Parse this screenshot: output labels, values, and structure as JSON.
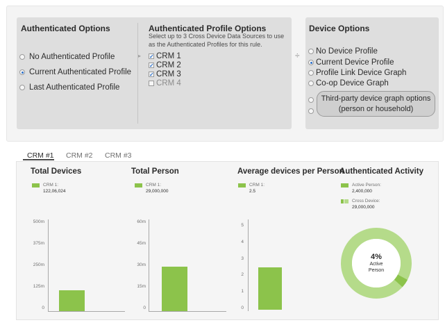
{
  "auth_options": {
    "title": "Authenticated Options",
    "items": [
      {
        "label": "No Authenticated Profile",
        "selected": false
      },
      {
        "label": "Current Authenticated Profile",
        "selected": true
      },
      {
        "label": "Last Authenticated Profile",
        "selected": false
      }
    ]
  },
  "profile_options": {
    "title": "Authenticated Profile Options",
    "description": "Select up to 3 Cross Device Data Sources to use as the Authenticated Profiles for this rule.",
    "items": [
      {
        "label": "CRM 1",
        "checked": true
      },
      {
        "label": "CRM 2",
        "checked": true
      },
      {
        "label": "CRM 3",
        "checked": true
      },
      {
        "label": "CRM 4",
        "checked": false
      }
    ]
  },
  "device_options": {
    "title": "Device Options",
    "items": [
      {
        "label": "No Device Profile",
        "selected": false
      },
      {
        "label": "Current Device Profile",
        "selected": true
      },
      {
        "label": "Profile Link Device Graph",
        "selected": false
      },
      {
        "label": "Co-op Device Graph",
        "selected": false
      }
    ],
    "third_party_line1": "Third-party device graph options",
    "third_party_line2": "(person or household)"
  },
  "tabs": [
    "CRM #1",
    "CRM #2",
    "CRM #3"
  ],
  "accent_color": "#8cc34b",
  "selected_radio_color": "#2a6fc9",
  "chart_data": [
    {
      "type": "bar",
      "title": "Total Devices",
      "legend": {
        "label": "CRM 1:",
        "value": "122,06,024"
      },
      "categories": [
        "CRM 1"
      ],
      "values": [
        105
      ],
      "ylim": [
        0,
        500
      ],
      "ticks": [
        "500m",
        "375m",
        "250m",
        "125m",
        "0"
      ]
    },
    {
      "type": "bar",
      "title": "Total Person",
      "legend": {
        "label": "CRM 1:",
        "value": "29,000,000"
      },
      "categories": [
        "CRM 1"
      ],
      "values": [
        29
      ],
      "ylim": [
        0,
        60
      ],
      "ticks": [
        "60m",
        "45m",
        "30m",
        "15m",
        "0"
      ]
    },
    {
      "type": "bar",
      "title": "Average devices per Person",
      "legend": {
        "label": "CRM 1:",
        "value": "2.5"
      },
      "categories": [
        "CRM 1"
      ],
      "values": [
        2.5
      ],
      "ylim": [
        0,
        6
      ],
      "ticks": [
        "5",
        "4",
        "3",
        "2",
        "1",
        "0"
      ]
    },
    {
      "type": "pie",
      "title": "Authenticated Activity",
      "legend": [
        {
          "label": "Active Person:",
          "value": "2,400,000"
        },
        {
          "label": "Cross Device:",
          "value": "29,000,000"
        }
      ],
      "center_value": "4%",
      "center_label_line1": "Active",
      "center_label_line2": "Person",
      "slices": [
        {
          "name": "Active Person",
          "value": 4
        },
        {
          "name": "Cross Device",
          "value": 96
        }
      ]
    }
  ]
}
